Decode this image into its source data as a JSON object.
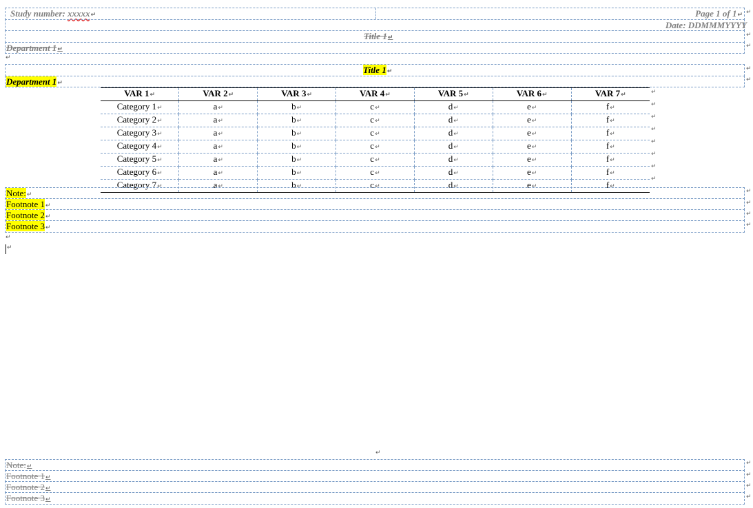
{
  "header": {
    "study_label": "Study number: ",
    "study_value": "xxxxx",
    "page": "Page 1 of 1",
    "date": "Date: DDMMMYYYY",
    "title": "Title 1",
    "department": "Department 1"
  },
  "body": {
    "title": "Title 1",
    "department": "Department 1"
  },
  "table": {
    "columns": [
      "VAR 1",
      "VAR 2",
      "VAR 3",
      "VAR 4",
      "VAR 5",
      "VAR 6",
      "VAR 7"
    ],
    "rows": [
      [
        "Category 1",
        "a",
        "b",
        "c",
        "d",
        "e",
        "f"
      ],
      [
        "Category 2",
        "a",
        "b",
        "c",
        "d",
        "e",
        "f"
      ],
      [
        "Category 3",
        "a",
        "b",
        "c",
        "d",
        "e",
        "f"
      ],
      [
        "Category 4",
        "a",
        "b",
        "c",
        "d",
        "e",
        "f"
      ],
      [
        "Category 5",
        "a",
        "b",
        "c",
        "d",
        "e",
        "f"
      ],
      [
        "Category 6",
        "a",
        "b",
        "c",
        "d",
        "e",
        "f"
      ],
      [
        "Category 7",
        "a",
        "b",
        "c",
        "d",
        "e",
        "f"
      ]
    ]
  },
  "notes": [
    "Note:",
    "Footnote 1",
    "Footnote 2",
    "Footnote 3"
  ],
  "footer_notes": [
    "Note:",
    "Footnote 1",
    "Footnote 2",
    "Footnote 3"
  ],
  "marks": {
    "cell_end": "↵"
  },
  "colors": {
    "highlight": "#ffff00",
    "grid": "#7a9cc6",
    "ghost_text": "#808080"
  }
}
